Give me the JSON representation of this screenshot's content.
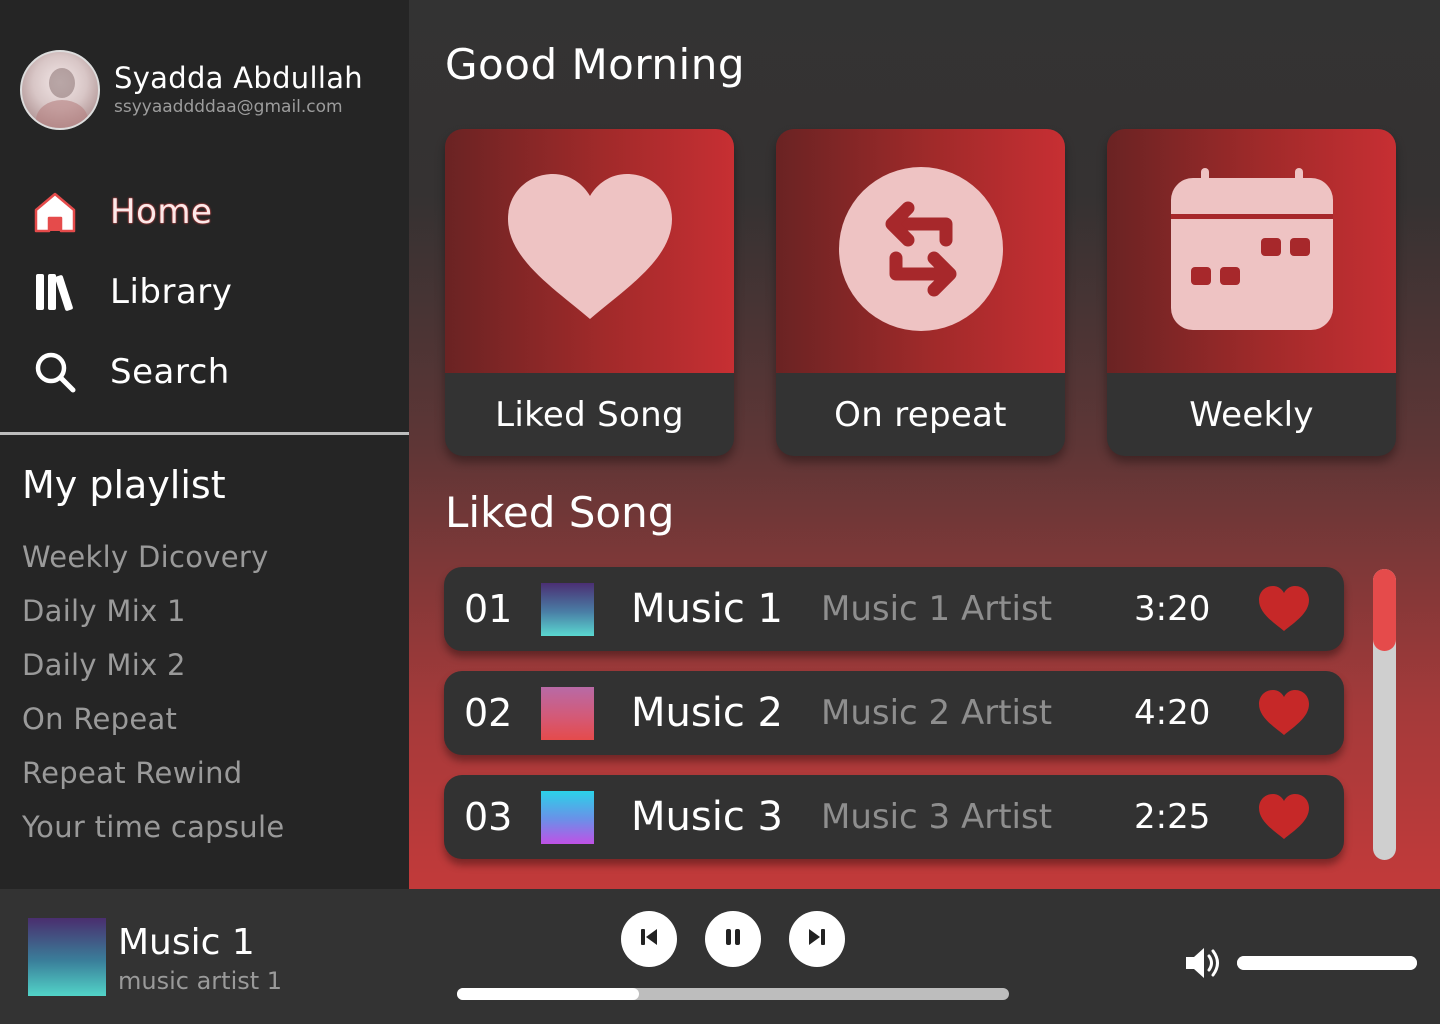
{
  "profile": {
    "name": "Syadda Abdullah",
    "email": "ssyyaaddddaa@gmail.com"
  },
  "nav": {
    "items": [
      {
        "label": "Home",
        "icon": "home-icon",
        "active": true
      },
      {
        "label": "Library",
        "icon": "library-icon",
        "active": false
      },
      {
        "label": "Search",
        "icon": "search-icon",
        "active": false
      }
    ]
  },
  "playlist": {
    "title": "My playlist",
    "items": [
      "Weekly Dicovery",
      "Daily Mix 1",
      "Daily Mix 2",
      "On Repeat",
      "Repeat Rewind",
      "Your time capsule"
    ]
  },
  "main": {
    "greeting": "Good Morning",
    "cards": [
      {
        "label": "Liked Song",
        "icon": "heart-icon"
      },
      {
        "label": "On repeat",
        "icon": "repeat-icon"
      },
      {
        "label": "Weekly",
        "icon": "calendar-icon"
      }
    ],
    "section_title": "Liked Song",
    "songs": [
      {
        "num": "01",
        "title": "Music 1",
        "artist": "Music 1 Artist",
        "duration": "3:20"
      },
      {
        "num": "02",
        "title": "Music 2",
        "artist": "Music 2 Artist",
        "duration": "4:20"
      },
      {
        "num": "03",
        "title": "Music 3",
        "artist": "Music 3 Artist",
        "duration": "2:25"
      }
    ]
  },
  "player": {
    "title": "Music 1",
    "artist": "music artist 1",
    "progress": 0.33,
    "volume": 1.0
  },
  "colors": {
    "accent": "#e54b4b",
    "heart": "#c62828",
    "card_icon": "#eec3c3",
    "sidebar_bg": "#252525",
    "panel_bg": "#333333"
  }
}
